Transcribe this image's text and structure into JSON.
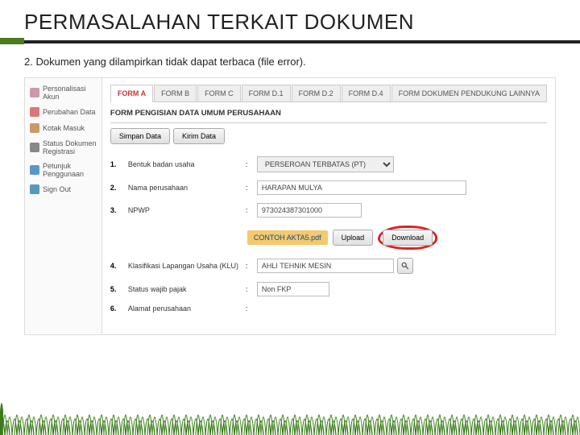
{
  "slide": {
    "title": "PERMASALAHAN TERKAIT DOKUMEN",
    "subheading_num": "2.",
    "subheading_text": "Dokumen yang dilampirkan tidak dapat terbaca (file error)."
  },
  "sidebar": {
    "items": [
      {
        "label": "Personalisasi Akun"
      },
      {
        "label": "Perubahan Data"
      },
      {
        "label": "Kotak Masuk"
      },
      {
        "label": "Status Dokumen Registrasi"
      },
      {
        "label": "Petunjuk Penggunaan"
      },
      {
        "label": "Sign Out"
      }
    ]
  },
  "tabs": [
    {
      "label": "FORM A",
      "active": true
    },
    {
      "label": "FORM B"
    },
    {
      "label": "FORM C"
    },
    {
      "label": "FORM D.1"
    },
    {
      "label": "FORM D.2"
    },
    {
      "label": "FORM D.4"
    },
    {
      "label": "FORM DOKUMEN PENDUKUNG LAINNYA"
    }
  ],
  "form": {
    "title": "FORM PENGISIAN DATA UMUM PERUSAHAAN",
    "save_label": "Simpan Data",
    "send_label": "Kirim Data",
    "rows": [
      {
        "num": "1.",
        "label": "Bentuk badan usaha",
        "value": "PERSEROAN TERBATAS (PT)"
      },
      {
        "num": "2.",
        "label": "Nama perusahaan",
        "value": "HARAPAN MULYA"
      },
      {
        "num": "3.",
        "label": "NPWP",
        "value": "973024387301000"
      },
      {
        "num": "4.",
        "label": "Klasifikasi Lapangan Usaha (KLU)",
        "value": "AHLI TEHNIK MESIN"
      },
      {
        "num": "5.",
        "label": "Status wajib pajak",
        "value": "Non FKP"
      },
      {
        "num": "6.",
        "label": "Alamat perusahaan",
        "value": ""
      }
    ],
    "file_name": "CONTOH AKTA5.pdf",
    "upload_label": "Upload",
    "download_label": "Download"
  }
}
